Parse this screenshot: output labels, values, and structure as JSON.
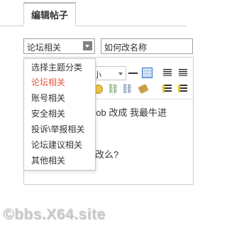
{
  "tab": {
    "label": "编辑帖子"
  },
  "category_select": {
    "value": "论坛相关"
  },
  "subject": {
    "value": "如何改名称"
  },
  "toolbar": {
    "font_size": "小",
    "icons": [
      "horizontal-rule-icon",
      "table-icon",
      "align-left-icon",
      "align-center-icon",
      "emoticon-icon",
      "link-icon",
      "unlink-icon",
      "clear-format-icon",
      "ordered-list-icon",
      "unordered-list-icon"
    ]
  },
  "body": {
    "line1": "kerbob 改成 我最牛进",
    "line2": "改么?"
  },
  "dropdown": {
    "options": [
      "选择主题分类",
      "论坛相关",
      "账号相关",
      "安全相关",
      "投诉\\举报相关",
      "论坛建议相关",
      "其他相关"
    ],
    "selected_index": 1
  },
  "watermark": {
    "text": "©bbs.X64.site"
  },
  "colors": {
    "accent": "#e0553d",
    "border": "#cdcdcd",
    "select_arrow": "#808080"
  }
}
